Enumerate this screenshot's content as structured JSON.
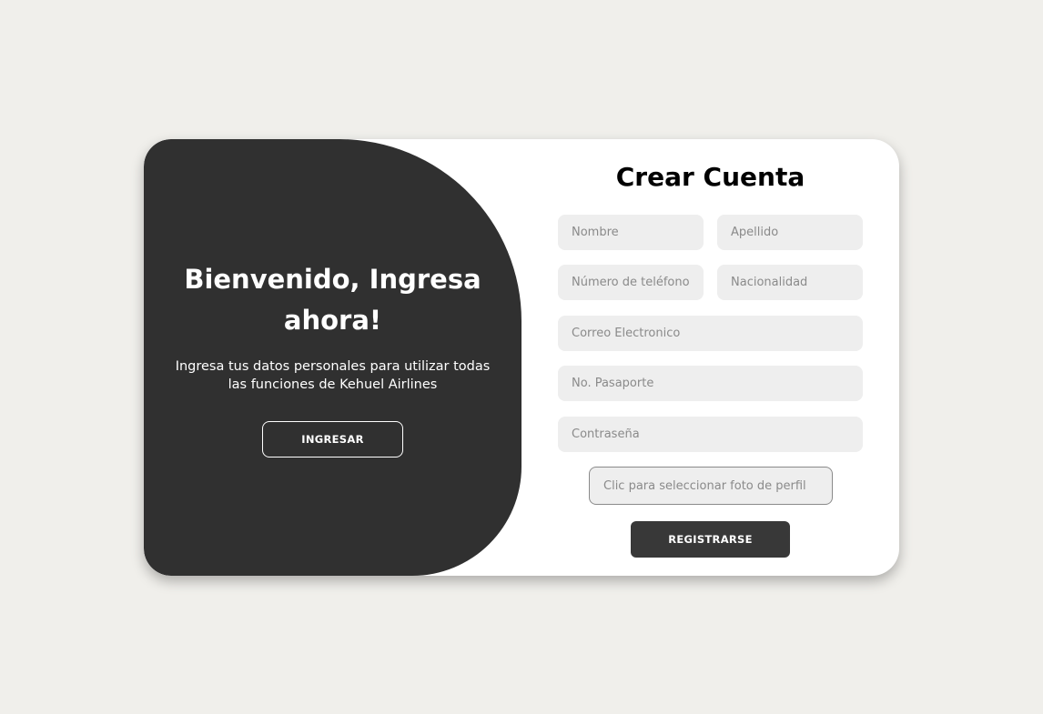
{
  "welcome": {
    "title": "Bienvenido, Ingresa ahora!",
    "description": "Ingresa tus datos personales para utilizar todas las funciones de Kehuel Airlines",
    "login_label": "INGRESAR"
  },
  "form": {
    "title": "Crear Cuenta",
    "fields": {
      "nombre": {
        "placeholder": "Nombre",
        "value": ""
      },
      "apellido": {
        "placeholder": "Apellido",
        "value": ""
      },
      "telefono": {
        "placeholder": "Número de teléfono",
        "value": ""
      },
      "nacionalidad": {
        "placeholder": "Nacionalidad",
        "value": ""
      },
      "correo": {
        "placeholder": "Correo Electronico",
        "value": ""
      },
      "pasaporte": {
        "placeholder": "No. Pasaporte",
        "value": ""
      },
      "contrasena": {
        "placeholder": "Contraseña",
        "value": ""
      },
      "foto": {
        "placeholder": "Clic para seleccionar foto de perfil",
        "value": ""
      }
    },
    "register_label": "REGISTRARSE"
  },
  "colors": {
    "background": "#f0efeb",
    "panel_dark": "#303030",
    "card": "#ffffff",
    "input_bg": "#eeeeee",
    "button_dark": "#383838"
  }
}
